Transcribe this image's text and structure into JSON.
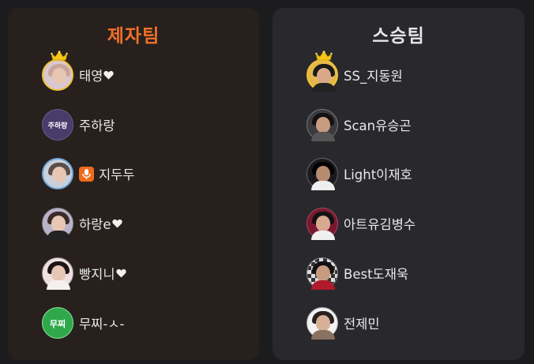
{
  "teams": {
    "left": {
      "title": "제자팀",
      "members": [
        {
          "name": "태영",
          "heart": true,
          "crown": true,
          "avatar": "avatar-photo-woman"
        },
        {
          "name": "주하랑",
          "heart": false,
          "crown": false,
          "avatar": "avatar-text-logo",
          "avatar_text": "주하랑"
        },
        {
          "name": "지두두",
          "heart": false,
          "crown": false,
          "avatar": "avatar-photo-woman",
          "mic_badge": true
        },
        {
          "name": "하랑e",
          "heart": true,
          "crown": false,
          "avatar": "avatar-photo-woman"
        },
        {
          "name": "빵지니",
          "heart": true,
          "crown": false,
          "avatar": "avatar-photo-woman"
        },
        {
          "name": "무찌-ㅅ-",
          "heart": false,
          "crown": false,
          "avatar": "avatar-text-logo",
          "avatar_text": "무찌"
        }
      ]
    },
    "right": {
      "title": "스승팀",
      "members": [
        {
          "name": "SS_지동원",
          "crown": true,
          "avatar": "avatar-photo-man"
        },
        {
          "name": "Scan유승곤",
          "crown": false,
          "avatar": "avatar-photo-man"
        },
        {
          "name": "Light이재호",
          "crown": false,
          "avatar": "avatar-photo-man"
        },
        {
          "name": "아트유김병수",
          "crown": false,
          "avatar": "avatar-photo-man"
        },
        {
          "name": "Best도재욱",
          "crown": false,
          "avatar": "avatar-photo-man"
        },
        {
          "name": "전제민",
          "crown": false,
          "avatar": "avatar-photo-man"
        }
      ]
    }
  },
  "colors": {
    "background": "#1c1c1f",
    "left_panel": "#27201d",
    "right_panel": "#29292d",
    "left_title": "#f0702a",
    "right_title": "#e6e6e6",
    "text": "#e8e8e8",
    "crown": "#f5c518",
    "mic_badge": "#ee6a1c"
  }
}
